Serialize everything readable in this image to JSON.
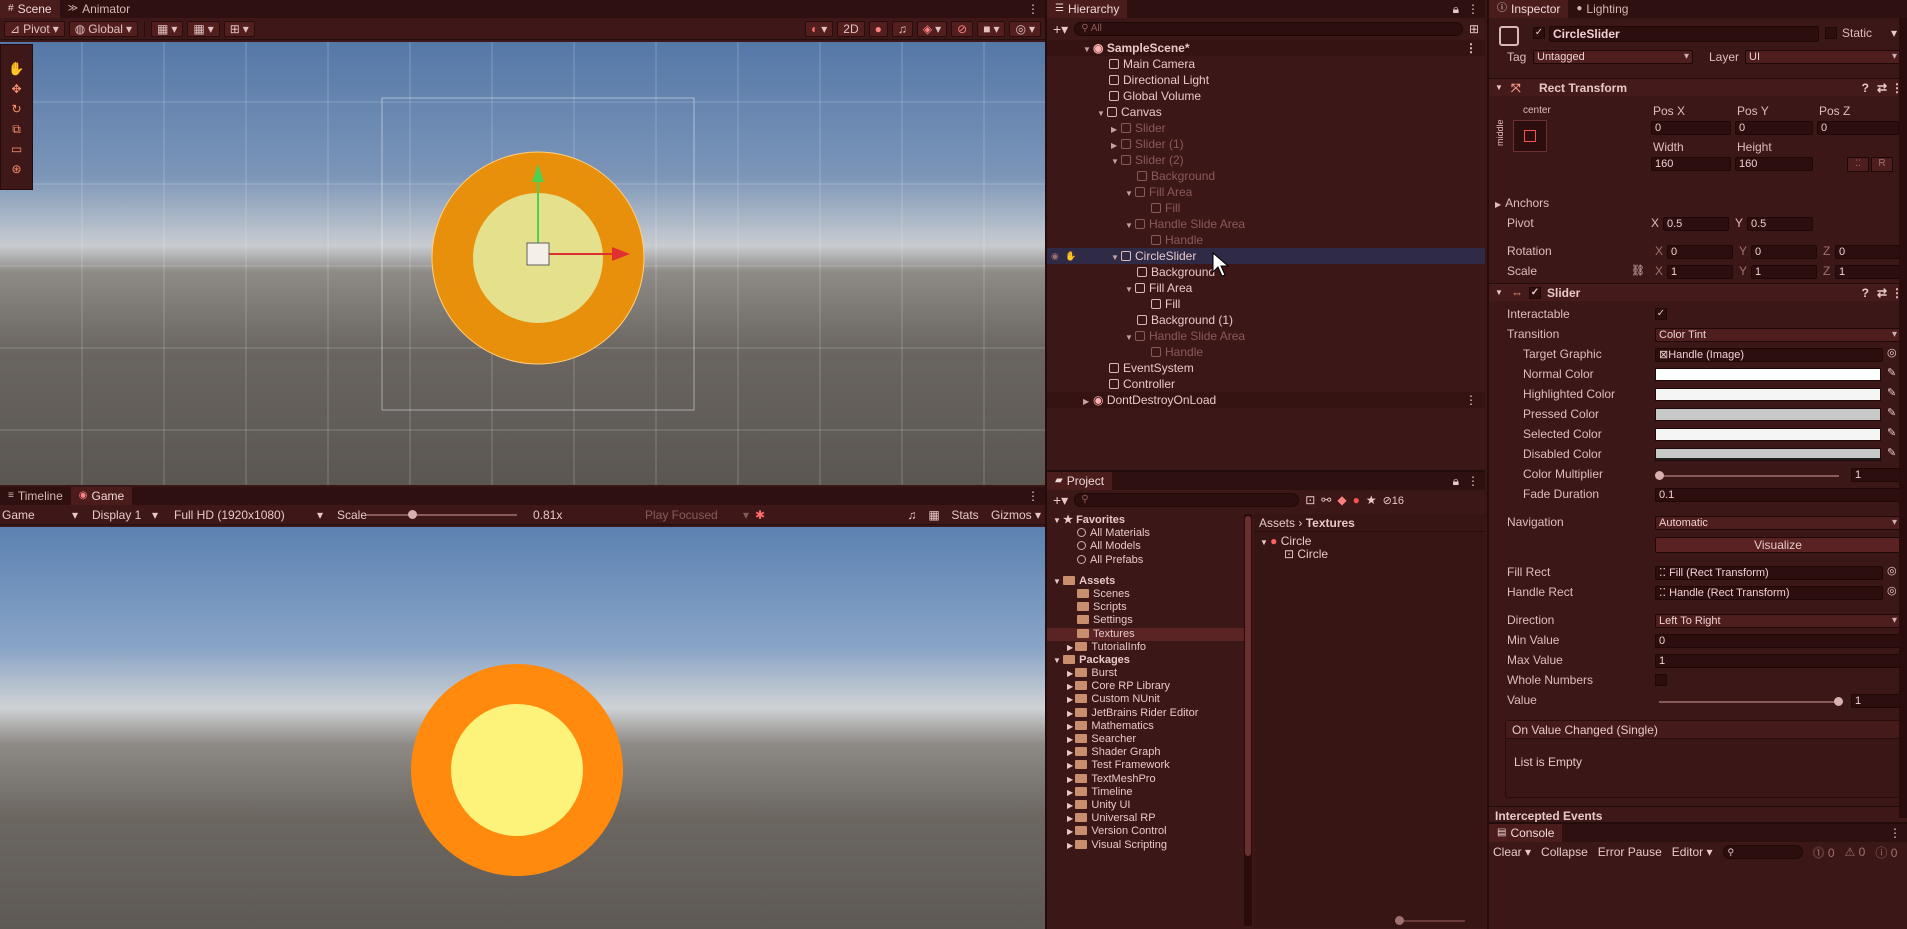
{
  "scene_panel": {
    "tabs": [
      {
        "label": "Scene"
      },
      {
        "label": "Animator"
      }
    ],
    "pivot_label": "Pivot",
    "global_label": "Global",
    "btn_2d": "2D"
  },
  "game_panel": {
    "tabs": [
      {
        "label": "Timeline"
      },
      {
        "label": "Game"
      }
    ],
    "game_dropdown": "Game",
    "display": "Display 1",
    "resolution": "Full HD (1920x1080)",
    "scale_label": "Scale",
    "scale_value": "0.81x",
    "play_focused": "Play Focused",
    "stats": "Stats",
    "gizmos": "Gizmos",
    "scale_fraction": 0.3
  },
  "hierarchy": {
    "title": "Hierarchy",
    "search_placeholder": "All",
    "items": [
      {
        "label": "SampleScene*"
      },
      {
        "label": "Main Camera"
      },
      {
        "label": "Directional Light"
      },
      {
        "label": "Global Volume"
      },
      {
        "label": "Canvas"
      },
      {
        "label": "Slider"
      },
      {
        "label": "Slider (1)"
      },
      {
        "label": "Slider (2)"
      },
      {
        "label": "Background"
      },
      {
        "label": "Fill Area"
      },
      {
        "label": "Fill"
      },
      {
        "label": "Handle Slide Area"
      },
      {
        "label": "Handle"
      },
      {
        "label": "CircleSlider"
      },
      {
        "label": "Background"
      },
      {
        "label": "Fill Area"
      },
      {
        "label": "Fill"
      },
      {
        "label": "Background (1)"
      },
      {
        "label": "Handle Slide Area"
      },
      {
        "label": "Handle"
      },
      {
        "label": "EventSystem"
      },
      {
        "label": "Controller"
      },
      {
        "label": "DontDestroyOnLoad"
      }
    ]
  },
  "project": {
    "title": "Project",
    "hidden_count": "16",
    "favorites_label": "Favorites",
    "favorites": [
      {
        "label": "All Materials"
      },
      {
        "label": "All Models"
      },
      {
        "label": "All Prefabs"
      }
    ],
    "assets_label": "Assets",
    "assets": [
      {
        "label": "Scenes"
      },
      {
        "label": "Scripts"
      },
      {
        "label": "Settings"
      },
      {
        "label": "Textures"
      },
      {
        "label": "TutorialInfo"
      }
    ],
    "packages_label": "Packages",
    "packages": [
      {
        "label": "Burst"
      },
      {
        "label": "Core RP Library"
      },
      {
        "label": "Custom NUnit"
      },
      {
        "label": "JetBrains Rider Editor"
      },
      {
        "label": "Mathematics"
      },
      {
        "label": "Searcher"
      },
      {
        "label": "Shader Graph"
      },
      {
        "label": "Test Framework"
      },
      {
        "label": "TextMeshPro"
      },
      {
        "label": "Timeline"
      },
      {
        "label": "Unity UI"
      },
      {
        "label": "Universal RP"
      },
      {
        "label": "Version Control"
      },
      {
        "label": "Visual Scripting"
      }
    ],
    "breadcrumb": {
      "root": "Assets",
      "current": "Textures"
    },
    "files": [
      {
        "label": "Circle"
      },
      {
        "label": "Circle"
      }
    ]
  },
  "inspector": {
    "tabs": [
      {
        "label": "Inspector"
      },
      {
        "label": "Lighting"
      }
    ],
    "object_name": "CircleSlider",
    "static_label": "Static",
    "tag_label": "Tag",
    "tag_value": "Untagged",
    "layer_label": "Layer",
    "layer_value": "UI",
    "rect_transform": {
      "title": "Rect Transform",
      "anchor_h": "center",
      "anchor_v": "middle",
      "pos_x_label": "Pos X",
      "pos_x": "0",
      "pos_y_label": "Pos Y",
      "pos_y": "0",
      "pos_z_label": "Pos Z",
      "pos_z": "0",
      "width_label": "Width",
      "width": "160",
      "height_label": "Height",
      "height": "160",
      "r_btn": "R",
      "anchors_label": "Anchors",
      "pivot_label": "Pivot",
      "pivot_x": "0.5",
      "pivot_y": "0.5",
      "rotation_label": "Rotation",
      "rot_x": "0",
      "rot_y": "0",
      "rot_z": "0",
      "scale_label": "Scale",
      "scale_x": "1",
      "scale_y": "1",
      "scale_z": "1",
      "x": "X",
      "y": "Y",
      "z": "Z"
    },
    "slider": {
      "title": "Slider",
      "interactable_label": "Interactable",
      "transition_label": "Transition",
      "transition_value": "Color Tint",
      "target_graphic_label": "Target Graphic",
      "target_graphic_value": "Handle (Image)",
      "normal_color_label": "Normal Color",
      "highlighted_color_label": "Highlighted Color",
      "pressed_color_label": "Pressed Color",
      "selected_color_label": "Selected Color",
      "disabled_color_label": "Disabled Color",
      "color_multiplier_label": "Color Multiplier",
      "color_multiplier_value": "1",
      "fade_duration_label": "Fade Duration",
      "fade_duration_value": "0.1",
      "navigation_label": "Navigation",
      "navigation_value": "Automatic",
      "visualize": "Visualize",
      "fill_rect_label": "Fill Rect",
      "fill_rect_value": "Fill (Rect Transform)",
      "handle_rect_label": "Handle Rect",
      "handle_rect_value": "Handle (Rect Transform)",
      "direction_label": "Direction",
      "direction_value": "Left To Right",
      "min_value_label": "Min Value",
      "min_value": "0",
      "max_value_label": "Max Value",
      "max_value": "1",
      "whole_numbers_label": "Whole Numbers",
      "value_label": "Value",
      "value": "1",
      "event_title": "On Value Changed (Single)",
      "event_empty": "List is Empty"
    },
    "intercepted_events": "Intercepted Events"
  },
  "console": {
    "title": "Console",
    "clear": "Clear",
    "collapse": "Collapse",
    "error_pause": "Error Pause",
    "editor": "Editor",
    "count_errors": "0",
    "count_warnings": "0",
    "count_logs": "0"
  },
  "colors": {
    "orange_ring": "#ff8a0e",
    "inner_fill": "#fdf27a",
    "sky_top": "#5a7fae",
    "ground": "#5c5854"
  }
}
